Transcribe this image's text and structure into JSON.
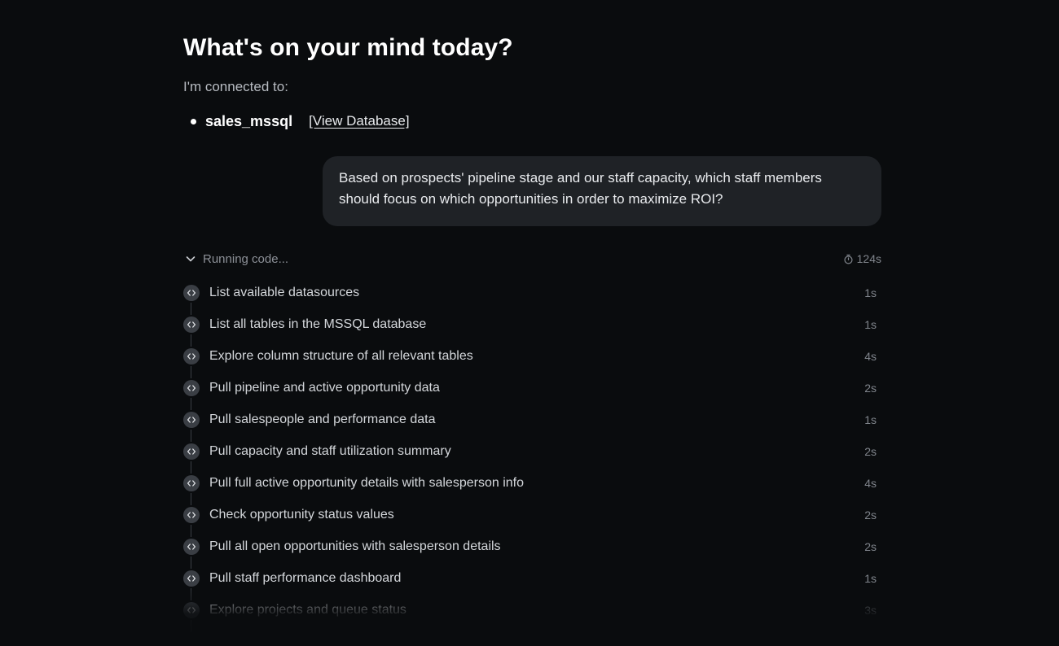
{
  "header": {
    "title": "What's on your mind today?",
    "connected_label": "I'm connected to:"
  },
  "datasource": {
    "name": "sales_mssql",
    "link_label": "[View Database]"
  },
  "user_message": {
    "text": "Based on prospects' pipeline stage and our staff capacity, which staff members should focus on which opportunities in order to maximize ROI?"
  },
  "run": {
    "status_label": "Running code...",
    "elapsed": "124s",
    "steps": [
      {
        "label": "List available datasources",
        "duration": "1s"
      },
      {
        "label": "List all tables in the MSSQL database",
        "duration": "1s"
      },
      {
        "label": "Explore column structure of all relevant tables",
        "duration": "4s"
      },
      {
        "label": "Pull pipeline and active opportunity data",
        "duration": "2s"
      },
      {
        "label": "Pull salespeople and performance data",
        "duration": "1s"
      },
      {
        "label": "Pull capacity and staff utilization summary",
        "duration": "2s"
      },
      {
        "label": "Pull full active opportunity details with salesperson info",
        "duration": "4s"
      },
      {
        "label": "Check opportunity status values",
        "duration": "2s"
      },
      {
        "label": "Pull all open opportunities with salesperson details",
        "duration": "2s"
      },
      {
        "label": "Pull staff performance dashboard",
        "duration": "1s"
      },
      {
        "label": "Explore projects and queue status",
        "duration": "3s"
      }
    ]
  },
  "icons": {
    "step_icon": "code-icon",
    "collapse_icon": "chevron-down-icon",
    "timer_icon": "stopwatch-icon"
  },
  "colors": {
    "background": "#0a0c0e",
    "bubble": "#1f2226",
    "step_icon_bg": "#3a3e44"
  }
}
